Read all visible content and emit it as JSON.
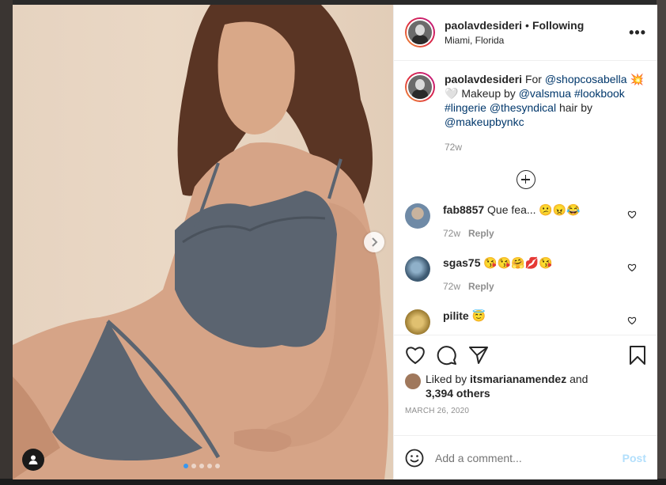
{
  "post": {
    "username": "paolavdesideri",
    "separator": "•",
    "follow_status": "Following",
    "location": "Miami, Florida"
  },
  "caption": {
    "username": "paolavdesideri",
    "parts": {
      "p1": "For ",
      "m1": "@shopcosabella",
      "p2": " 💥🤍 Makeup by ",
      "m2": "@valsmua",
      "t1": "#lookbook",
      "t2": "#lingerie",
      "m3": "@thesyndical",
      "p3": " hair by ",
      "m4": "@makeupbynkc"
    },
    "age": "72w"
  },
  "comments": [
    {
      "username": "fab8857",
      "text": "Que fea... 😕😠😂",
      "age": "72w",
      "reply": "Reply",
      "avatar_color": "#6f8aa6"
    },
    {
      "username": "sgas75",
      "text": "😘😘🤗💋😘",
      "age": "72w",
      "reply": "Reply",
      "avatar_color": "#5b7a9a"
    },
    {
      "username": "pilite",
      "text": "😇",
      "age": "",
      "reply": "",
      "avatar_color": "#c9a24a"
    }
  ],
  "likes": {
    "prefix": "Liked by ",
    "user": "itsmarianamendez",
    "mid": " and",
    "count": "3,394 others"
  },
  "date": "MARCH 26, 2020",
  "add_comment": {
    "placeholder": "Add a comment...",
    "post_label": "Post"
  },
  "carousel": {
    "count": 5,
    "active_index": 0
  },
  "colors": {
    "accent": "#3897f0",
    "link": "#00376b",
    "post_disabled": "#b2dffc"
  },
  "icons": [
    "more-icon",
    "plus-circle-icon",
    "heart-icon",
    "comment-icon",
    "share-icon",
    "bookmark-icon",
    "emoji-icon",
    "user-tag-icon",
    "chevron-right-icon"
  ]
}
